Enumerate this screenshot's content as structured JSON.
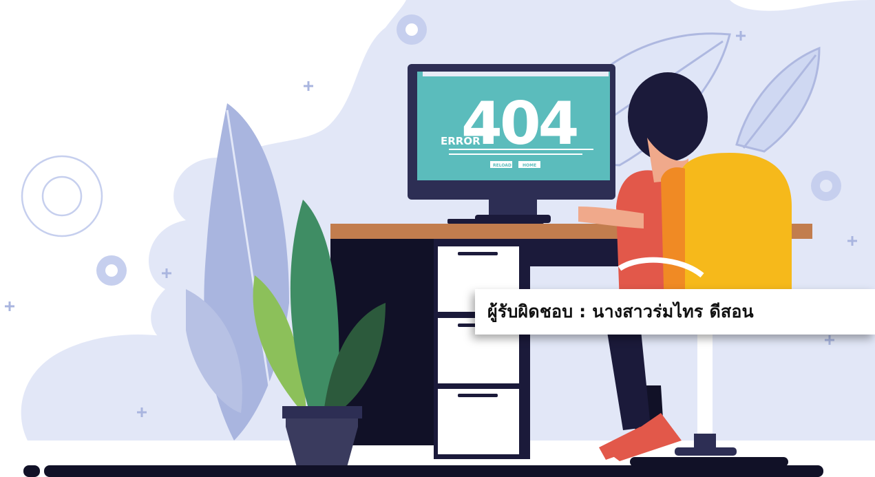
{
  "screen": {
    "error_prefix": "ERROR",
    "error_code": "404",
    "buttons": {
      "reload": "RELOAD",
      "home": "HOME"
    }
  },
  "banner": {
    "text": "ผู้รับผิดชอบ : นางสาวร่มไทร  ดีสอน"
  },
  "colors": {
    "background_blob": "#e2e7f7",
    "screen": "#5bbcbc",
    "chair": "#f6b91b",
    "shirt": "#e2584a",
    "desk_top": "#c27d4e",
    "dark": "#1b1a3a"
  },
  "icons": [
    "gear-icon",
    "plus-icon",
    "leaf-icon",
    "plant-icon"
  ]
}
